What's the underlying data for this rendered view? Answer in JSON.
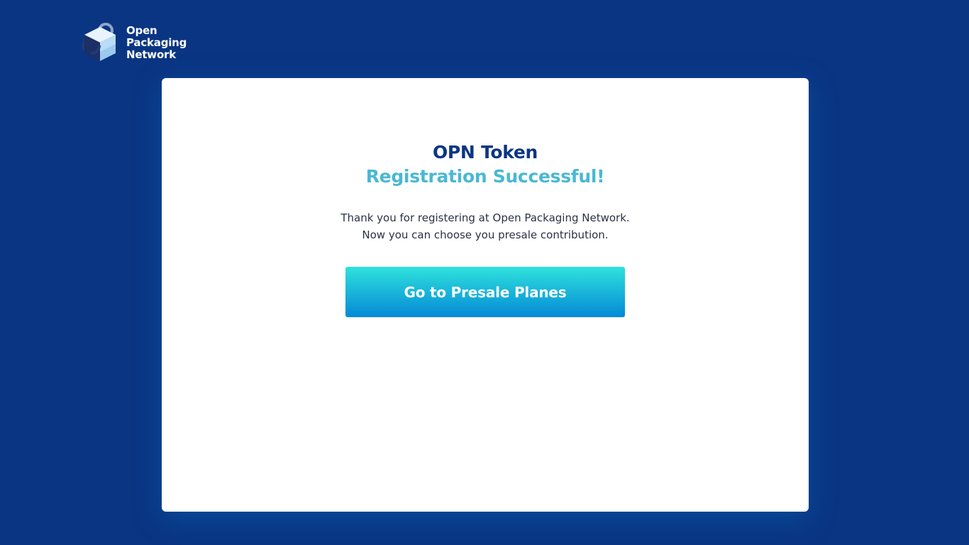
{
  "brand": {
    "name_lines": [
      "Open",
      "Packaging",
      "Network"
    ],
    "logo_icon": "opn-cube-logo-icon"
  },
  "card": {
    "title": "OPN Token",
    "subtitle": "Registration Successful!",
    "message_lines": [
      "Thank you for registering at Open Packaging Network.",
      "Now you can choose you presale contribution."
    ],
    "cta_label": "Go to Presale Planes"
  },
  "colors": {
    "background": "#0a3583",
    "title": "#0b3683",
    "subtitle": "#4ab8d3",
    "button_top": "#2fe2dc",
    "button_bottom": "#0489d6"
  }
}
